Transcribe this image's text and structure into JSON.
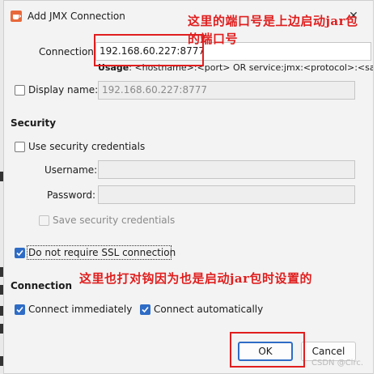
{
  "window": {
    "title": "Add JMX Connection",
    "close_glyph": "✕"
  },
  "connection": {
    "label": "Connection:",
    "value": "192.168.60.227:8777",
    "usage_bold": "Usage",
    "usage_text": ": <hostname>:<port> OR service:jmx:<protocol>:<sap"
  },
  "display_name": {
    "label": "Display name:",
    "value": "192.168.60.227:8777"
  },
  "security": {
    "heading": "Security",
    "use_credentials_label": "Use security credentials",
    "username_label": "Username:",
    "password_label": "Password:",
    "save_credentials_label": "Save security credentials",
    "no_ssl_label": "Do not require SSL connection"
  },
  "connection_section": {
    "heading": "Connection",
    "connect_immediately_label": "Connect immediately",
    "connect_automatically_label": "Connect automatically"
  },
  "buttons": {
    "ok_label": "OK",
    "cancel_label": "Cancel"
  },
  "annotations": {
    "top_line1": "这里的端口号是上边启动jar包",
    "top_line2": "的端口号",
    "middle": "这里也打对钩因为也是启动jar包时设置的"
  },
  "watermark": "CSDN @Circ.",
  "colors": {
    "accent": "#2e6cc6",
    "annotation_red": "#e01e1e"
  }
}
